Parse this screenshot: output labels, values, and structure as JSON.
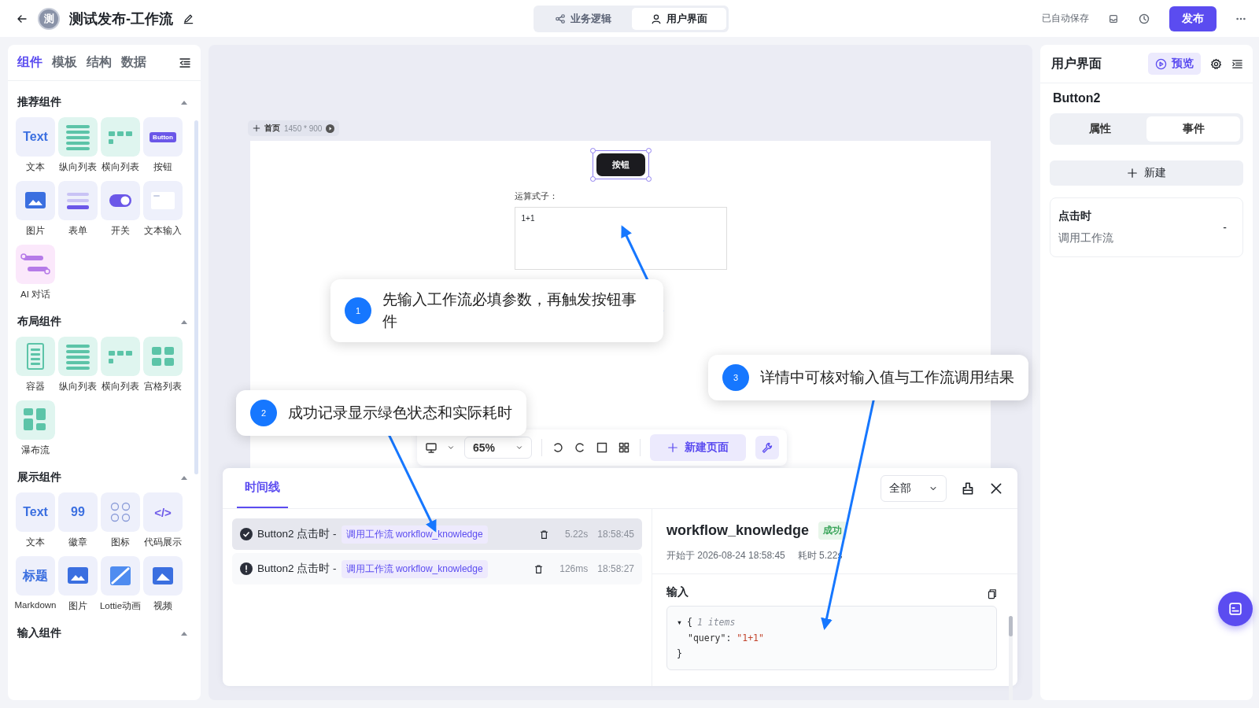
{
  "header": {
    "avatar": "测",
    "title": "测试发布-工作流",
    "mode_tabs": [
      {
        "label": "业务逻辑",
        "selected": false
      },
      {
        "label": "用户界面",
        "selected": true
      }
    ],
    "autosave": "已自动保存",
    "publish": "发布"
  },
  "left_panel": {
    "tabs": [
      {
        "label": "组件",
        "selected": true
      },
      {
        "label": "模板",
        "selected": false
      },
      {
        "label": "结构",
        "selected": false
      },
      {
        "label": "数据",
        "selected": false
      }
    ],
    "sections": [
      {
        "title": "推荐组件",
        "expanded": true,
        "items": [
          {
            "kind": "text",
            "glyph": "Text",
            "label": "文本"
          },
          {
            "kind": "vlist",
            "label": "纵向列表"
          },
          {
            "kind": "hlist",
            "label": "横向列表"
          },
          {
            "kind": "button",
            "glyph": "Button",
            "label": "按钮"
          },
          {
            "kind": "image",
            "label": "图片"
          },
          {
            "kind": "form",
            "label": "表单"
          },
          {
            "kind": "switch",
            "label": "开关"
          },
          {
            "kind": "textinput",
            "label": "文本输入"
          },
          {
            "kind": "ai",
            "label": "AI 对话"
          }
        ]
      },
      {
        "title": "布局组件",
        "expanded": true,
        "items": [
          {
            "kind": "container",
            "label": "容器"
          },
          {
            "kind": "vlist",
            "label": "纵向列表"
          },
          {
            "kind": "hlist",
            "label": "横向列表"
          },
          {
            "kind": "grid",
            "label": "宫格列表"
          },
          {
            "kind": "waterfall",
            "label": "瀑布流"
          }
        ]
      },
      {
        "title": "展示组件",
        "expanded": true,
        "items": [
          {
            "kind": "text",
            "glyph": "Text",
            "label": "文本"
          },
          {
            "kind": "badge",
            "glyph": "99",
            "label": "徽章"
          },
          {
            "kind": "icons",
            "label": "图标"
          },
          {
            "kind": "code",
            "glyph": "</>",
            "label": "代码展示"
          },
          {
            "kind": "heading",
            "glyph": "标题",
            "label": "Markdown"
          },
          {
            "kind": "image",
            "label": "图片"
          },
          {
            "kind": "lottie",
            "label": "Lottie动画"
          },
          {
            "kind": "video",
            "label": "视频"
          }
        ]
      },
      {
        "title": "输入组件",
        "expanded": true
      }
    ]
  },
  "canvas": {
    "page_name": "首页",
    "page_size": "1450 * 900",
    "button": "按钮",
    "formula_label": "运算式子：",
    "formula_value": "1+1",
    "toolbar": {
      "zoom": "65%",
      "new_page": "新建页面"
    }
  },
  "timeline": {
    "tab": "时间线",
    "filter": "全部",
    "records": [
      {
        "kind": "success",
        "source": "Button2 点击时 -",
        "action": "调用工作流 workflow_knowledge",
        "duration": "5.22s",
        "time": "18:58:45",
        "selected": true
      },
      {
        "kind": "error",
        "source": "Button2 点击时 -",
        "action": "调用工作流 workflow_knowledge",
        "duration": "126ms",
        "time": "18:58:27",
        "selected": false
      }
    ],
    "detail": {
      "title": "workflow_knowledge",
      "status": "成功",
      "started": "开始于 2026-08-24 18:58:45",
      "elapsed": "耗时 5.22s",
      "input_label": "输入",
      "input_json": {
        "toggle": "▾",
        "open": "{",
        "summary": "1 items",
        "entries": [
          {
            "key": "\"query\"",
            "colon": ":",
            "value": "\"1+1\""
          }
        ],
        "close": "}"
      }
    }
  },
  "right_panel": {
    "title": "用户界面",
    "preview": "预览",
    "component": "Button2",
    "tabs": [
      {
        "label": "属性",
        "selected": false
      },
      {
        "label": "事件",
        "selected": true
      }
    ],
    "new_button": "新建",
    "events": [
      {
        "trigger": "点击时",
        "action": "调用工作流",
        "value": "-"
      }
    ]
  },
  "callouts": [
    {
      "number": "1",
      "text": "先输入工作流必填参数，再触发按钮事件"
    },
    {
      "number": "2",
      "text": "成功记录显示绿色状态和实际耗时"
    },
    {
      "number": "3",
      "text": "详情中可核对输入值与工作流调用结果"
    }
  ]
}
